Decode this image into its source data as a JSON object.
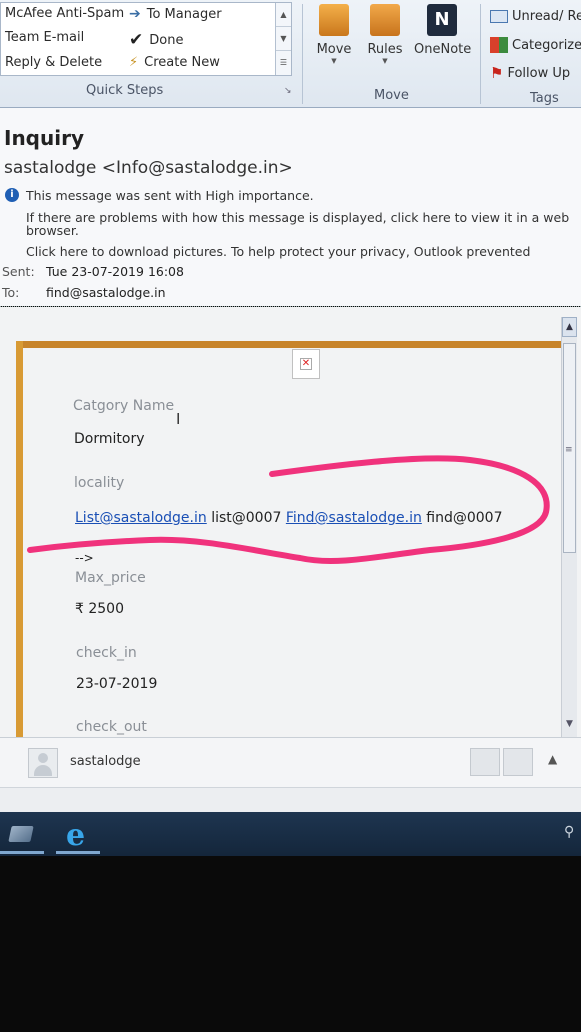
{
  "ribbon": {
    "quick_steps": {
      "items": [
        "McAfee Anti-Spam",
        "Team E-mail",
        "Reply & Delete",
        "To Manager",
        "Done",
        "Create New"
      ],
      "label": "Quick Steps"
    },
    "move": {
      "buttons": [
        "Move",
        "Rules",
        "OneNote"
      ],
      "label": "Move"
    },
    "tags": {
      "items": [
        "Unread/ Re",
        "Categorize",
        "Follow Up"
      ],
      "label": "Tags"
    }
  },
  "message": {
    "subject": "Inquiry",
    "sender": "sastalodge <Info@sastalodge.in>",
    "info_lines": [
      "This message was sent with High importance.",
      "If there are problems with how this message is displayed, click here to view it in a web",
      "browser.",
      "Click here to download pictures. To help protect your privacy, Outlook prevented"
    ],
    "sent_label": "Sent:",
    "sent_value": "Tue 23-07-2019 16:08",
    "to_label": "To:",
    "to_value": "find@sastalodge.in"
  },
  "body": {
    "category_label": "Catgory Name",
    "category_value": "Dormitory",
    "locality_label": "locality",
    "locality_link1": "List@sastalodge.in",
    "locality_text1": " list@0007 ",
    "locality_link2": "Find@sastalodge.in",
    "locality_text2": " find@0007",
    "arrow_text": "-->",
    "max_price_label": "Max_price",
    "max_price_value": "₹ 2500",
    "check_in_label": "check_in",
    "check_in_value": "23-07-2019",
    "check_out_label": "check_out"
  },
  "people_pane": {
    "name": "sastalodge"
  },
  "colors": {
    "frame_orange": "#c8842a",
    "link_blue": "#1a4fb5",
    "annotation_pink": "#f0327c"
  }
}
